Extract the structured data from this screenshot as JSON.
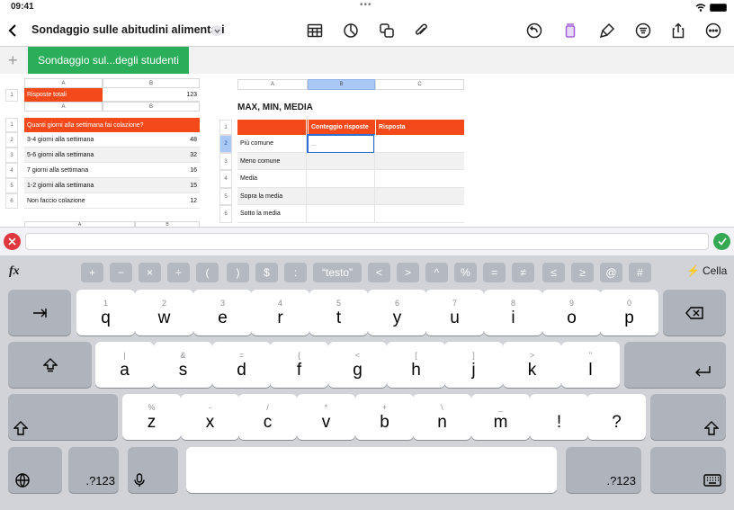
{
  "status": {
    "time": "09:41",
    "battery_pct": 100
  },
  "toolbar": {
    "title": "Sondaggio sulle abitudini alimentari"
  },
  "sheet_tab": {
    "add": "+",
    "label": "Sondaggio sul...degli studenti",
    "color": "#2bae5a"
  },
  "table_totals": {
    "col_a": "A",
    "col_b": "B",
    "row": "1",
    "label": "Risposte totali",
    "value": "123"
  },
  "table_breakfast": {
    "col_a": "A",
    "col_b": "B",
    "header": "Quanti giorni alla settimana fai colazione?",
    "rows": [
      {
        "n": "1"
      },
      {
        "n": "2",
        "label": "3-4 giorni alla settimana",
        "value": "48"
      },
      {
        "n": "3",
        "label": "5-6 giorni alla settimana",
        "value": "32"
      },
      {
        "n": "4",
        "label": "7 giorni alla settimana",
        "value": "16"
      },
      {
        "n": "5",
        "label": "1-2 giorni alla settimana",
        "value": "15"
      },
      {
        "n": "6",
        "label": "Non faccio colazione",
        "value": "12"
      }
    ],
    "next_cols": {
      "a": "A",
      "b": "B"
    }
  },
  "table_stats": {
    "cols": [
      "A",
      "B",
      "C"
    ],
    "title": "MAX, MIN, MEDIA",
    "headers": [
      "Conteggio risposte",
      "Risposta"
    ],
    "rows": [
      {
        "n": "1"
      },
      {
        "n": "2",
        "label": "Più comune",
        "value": "..."
      },
      {
        "n": "3",
        "label": "Meno comune"
      },
      {
        "n": "4",
        "label": "Media"
      },
      {
        "n": "5",
        "label": "Sopra la media"
      },
      {
        "n": "6",
        "label": "Sotto la media"
      }
    ],
    "accent": "#f44a1b"
  },
  "formula_bar": {
    "value": ""
  },
  "fn_row": {
    "fx": "fx",
    "keys": [
      "+",
      "−",
      "×",
      "÷",
      "(",
      ")",
      "$",
      ":",
      "“testo”",
      "<",
      ">",
      "^",
      "%",
      "=",
      "≠",
      "≤",
      "≥",
      "@",
      "#"
    ],
    "cella": "Cella"
  },
  "keyboard": {
    "row1": [
      [
        "1",
        "q"
      ],
      [
        "2",
        "w"
      ],
      [
        "3",
        "e"
      ],
      [
        "4",
        "r"
      ],
      [
        "5",
        "t"
      ],
      [
        "6",
        "y"
      ],
      [
        "7",
        "u"
      ],
      [
        "8",
        "i"
      ],
      [
        "9",
        "o"
      ],
      [
        "0",
        "p"
      ]
    ],
    "row2": [
      [
        "|",
        "a"
      ],
      [
        "&",
        "s"
      ],
      [
        "=",
        "d"
      ],
      [
        "{",
        "f"
      ],
      [
        "<",
        "g"
      ],
      [
        "[",
        "h"
      ],
      [
        "]",
        "j"
      ],
      [
        ">",
        "k"
      ],
      [
        "\"",
        "l"
      ]
    ],
    "row3": [
      [
        "%",
        "z"
      ],
      [
        "-",
        "x"
      ],
      [
        "/",
        "c"
      ],
      [
        "*",
        "v"
      ],
      [
        "+",
        "b"
      ],
      [
        "\\",
        "n"
      ],
      [
        "_",
        "m"
      ],
      [
        "",
        "!"
      ],
      [
        "",
        "?"
      ]
    ],
    "numbers": ".?123"
  }
}
